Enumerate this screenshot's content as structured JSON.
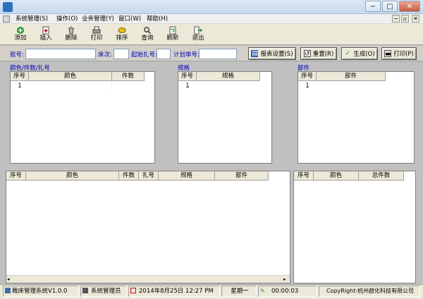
{
  "window": {
    "minimize": "−",
    "maximize": "□",
    "close": "✕",
    "restore": "▫",
    "mdi_close": "✕"
  },
  "menu": [
    {
      "label": "系统管理(S)"
    },
    {
      "label": "操作(O)"
    },
    {
      "label": "业务管理(Y)"
    },
    {
      "label": "窗口(W)"
    },
    {
      "label": "帮助(H)"
    }
  ],
  "toolbar": [
    {
      "label": "添加",
      "icon": "add-icon"
    },
    {
      "label": "插入",
      "icon": "insert-icon"
    },
    {
      "label": "删除",
      "icon": "delete-icon"
    },
    {
      "label": "打印",
      "icon": "print-icon"
    },
    {
      "label": "排序",
      "icon": "sort-icon"
    },
    {
      "label": "查询",
      "icon": "search-icon"
    },
    {
      "label": "刷新",
      "icon": "refresh-icon"
    },
    {
      "label": "退出",
      "icon": "exit-icon"
    }
  ],
  "search": {
    "kuanhao_label": "款号:",
    "kuanhao_value": "",
    "ciaci_label": "床次:",
    "ciaci_value": "",
    "start_label": "起始扎号:",
    "start_value": "",
    "plan_label": "计划单号:",
    "plan_value": ""
  },
  "buttons": {
    "report": "报表设置(S)",
    "reset": "重置(R)",
    "generate": "生成(O)",
    "print": "打印(P)"
  },
  "panels": {
    "color": {
      "title": "颜色/件数/扎号",
      "headers": [
        "序号",
        "颜色",
        "件数"
      ],
      "row": [
        "1",
        "",
        ""
      ]
    },
    "spec": {
      "title": "规格",
      "headers": [
        "序号",
        "规格"
      ],
      "row": [
        "1",
        ""
      ]
    },
    "part": {
      "title": "部件",
      "headers": [
        "序号",
        "部件"
      ],
      "row": [
        "1",
        ""
      ]
    }
  },
  "lower_left": {
    "headers": [
      "序号",
      "颜色",
      "件数",
      "扎号",
      "规格",
      "部件"
    ]
  },
  "lower_right": {
    "headers": [
      "序号",
      "颜色",
      "总件数"
    ]
  },
  "status": {
    "system": "裁床管理系统V1.0.0",
    "user": "系统管理员",
    "datetime": "2014年8月25日 12:27 PM",
    "weekday": "星期一",
    "timer": "00:00:03",
    "copyright": "CopyRight:杭州啟化科技有限公司"
  }
}
